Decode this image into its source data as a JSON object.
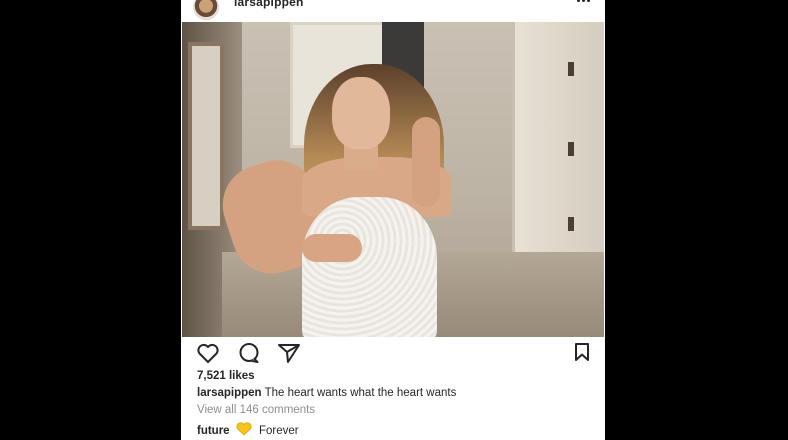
{
  "post": {
    "username": "larsapippen",
    "likes": "7,521 likes",
    "caption": {
      "username": "larsapippen",
      "text": "The heart wants what the heart wants"
    },
    "view_comments": "View all 146 comments",
    "top_comment": {
      "username": "future",
      "emoji_icon": "yellow-heart-icon",
      "text": "Forever"
    }
  },
  "icons": {
    "like": "heart-outline-icon",
    "comment": "comment-bubble-icon",
    "share": "paper-plane-icon",
    "save": "bookmark-icon",
    "more": "more-dots-icon"
  },
  "colors": {
    "background": "#000000",
    "card": "#ffffff",
    "text": "#262626",
    "muted": "#8e8e8e",
    "emoji_heart": "#f5c518"
  }
}
